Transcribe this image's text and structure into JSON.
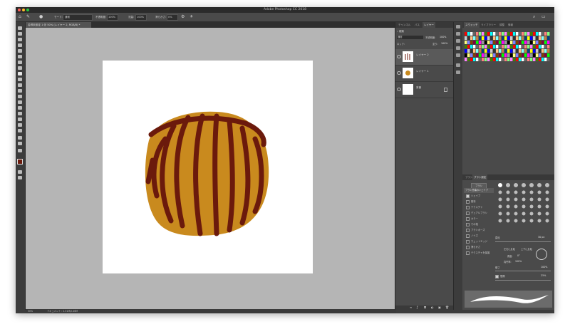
{
  "window": {
    "title": "Adobe Photoshop CC 2018"
  },
  "options_bar": {
    "mode_label": "モード:",
    "mode_value": "通常",
    "opacity_label": "不透明度:",
    "opacity_value": "100%",
    "flow_label": "流量:",
    "flow_value": "100%",
    "smoothing_label": "滑らかさ:",
    "smoothing_value": "0%"
  },
  "document_tab": {
    "label": "名称未設定 1 @ 50% (レイヤー 2, RGB/8) *"
  },
  "status_bar": {
    "zoom": "50%",
    "doc_info": "ドキュメント : 2.31M/2.46M"
  },
  "layers_panel": {
    "tabs": [
      "チャンネル",
      "パス",
      "レイヤー"
    ],
    "active_tab": "レイヤー",
    "kind_label": "種類",
    "blend_mode": "通常",
    "opacity_label": "不透明度:",
    "opacity_value": "100%",
    "lock_label": "ロック:",
    "fill_label": "塗り:",
    "fill_value": "100%",
    "layers": [
      {
        "name": "レイヤー 2"
      },
      {
        "name": "レイヤー 1"
      },
      {
        "name": "背景"
      }
    ]
  },
  "swatches_panel": {
    "tabs": [
      "スウォッチ",
      "ライブラリー",
      "調整",
      "情報"
    ],
    "active_tab": "スウォッチ"
  },
  "brush_panel": {
    "tabs": [
      "ブラシ",
      "ブラシ設定"
    ],
    "active_tab": "ブラシ設定",
    "brush_button": "ブラシ",
    "tip_shape_label": "ブラシ先端のシェイプ",
    "options": [
      {
        "label": "シェイプ",
        "checked": true
      },
      {
        "label": "散布",
        "checked": false
      },
      {
        "label": "テクスチャ",
        "checked": false
      },
      {
        "label": "デュアルブラシ",
        "checked": false
      },
      {
        "label": "カラー",
        "checked": false
      },
      {
        "label": "その他",
        "checked": false
      },
      {
        "label": "ブラシポーズ",
        "checked": false
      },
      {
        "label": "ノイズ",
        "checked": false
      },
      {
        "label": "ウェットエッジ",
        "checked": false
      },
      {
        "label": "滑らかさ",
        "checked": false
      },
      {
        "label": "テクスチャを保護",
        "checked": false
      }
    ],
    "size_label": "直径",
    "size_value": "30 px",
    "flip_x_label": "左右に反転",
    "flip_y_label": "上下に反転",
    "angle_label": "角度:",
    "angle_value": "0°",
    "roundness_label": "真円率:",
    "roundness_value": "100%",
    "hardness_label": "硬さ",
    "hardness_value": "100%",
    "spacing_label": "間隔",
    "spacing_value": "25%"
  },
  "colors": {
    "accent_dark": "#6b1a0c",
    "pumpkin": "#c98a1e",
    "workspace": "#b5b5b5"
  }
}
